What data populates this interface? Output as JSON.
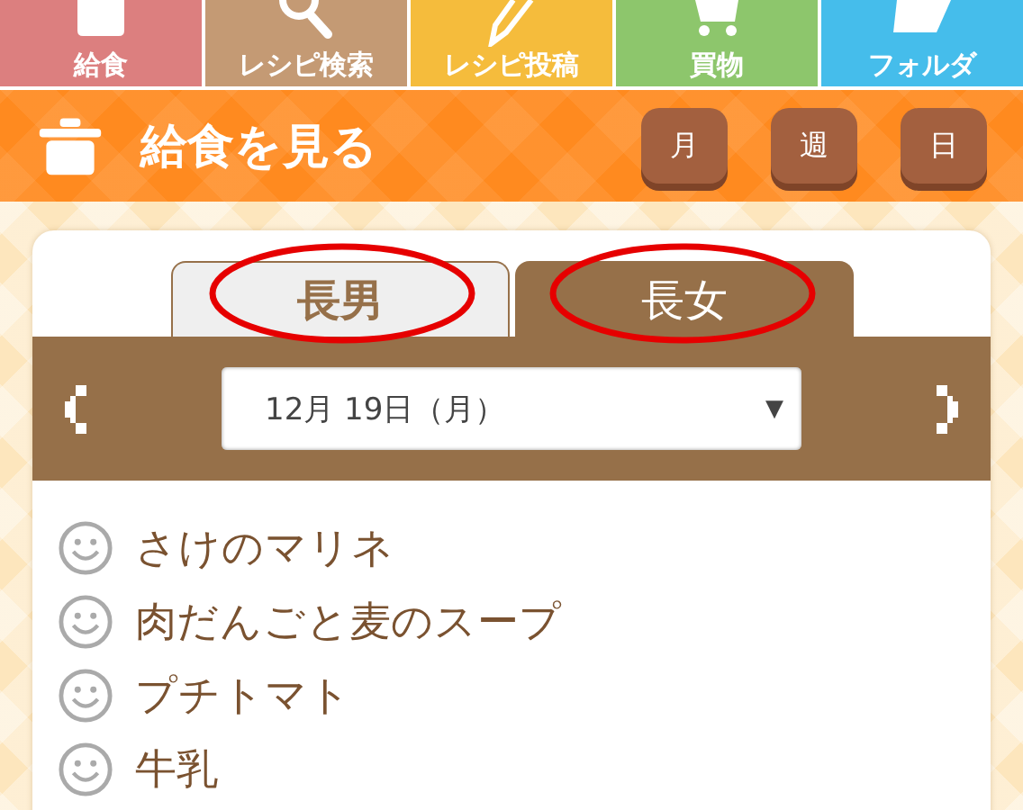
{
  "nav": [
    {
      "label": "給食",
      "kind": "box",
      "color": "#dc7f7f"
    },
    {
      "label": "レシピ検索",
      "kind": "search",
      "color": "#c49a74"
    },
    {
      "label": "レシピ投稿",
      "kind": "pencil",
      "color": "#f5bc3c"
    },
    {
      "label": "買物",
      "kind": "cart",
      "color": "#8dc66c"
    },
    {
      "label": "フォルダ",
      "kind": "folder",
      "color": "#45bdeb"
    }
  ],
  "header": {
    "title": "給食を見る",
    "buttons": [
      "月",
      "週",
      "日"
    ]
  },
  "tabs": [
    {
      "label": "長男",
      "selected": false
    },
    {
      "label": "長女",
      "selected": true
    }
  ],
  "date": {
    "value": "12月 19日（月）",
    "arrow": "▼"
  },
  "menu": [
    {
      "name": "さけのマリネ"
    },
    {
      "name": "肉だんごと麦のスープ"
    },
    {
      "name": "プチトマト"
    },
    {
      "name": "牛乳"
    }
  ]
}
